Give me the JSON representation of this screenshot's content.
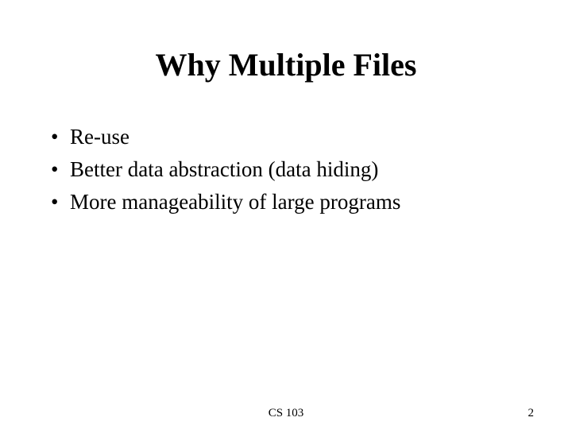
{
  "slide": {
    "title": "Why Multiple Files",
    "bullets": [
      "Re-use",
      "Better data abstraction (data hiding)",
      "More manageability of large programs"
    ],
    "footer": {
      "center": "CS 103",
      "page_number": "2"
    }
  }
}
